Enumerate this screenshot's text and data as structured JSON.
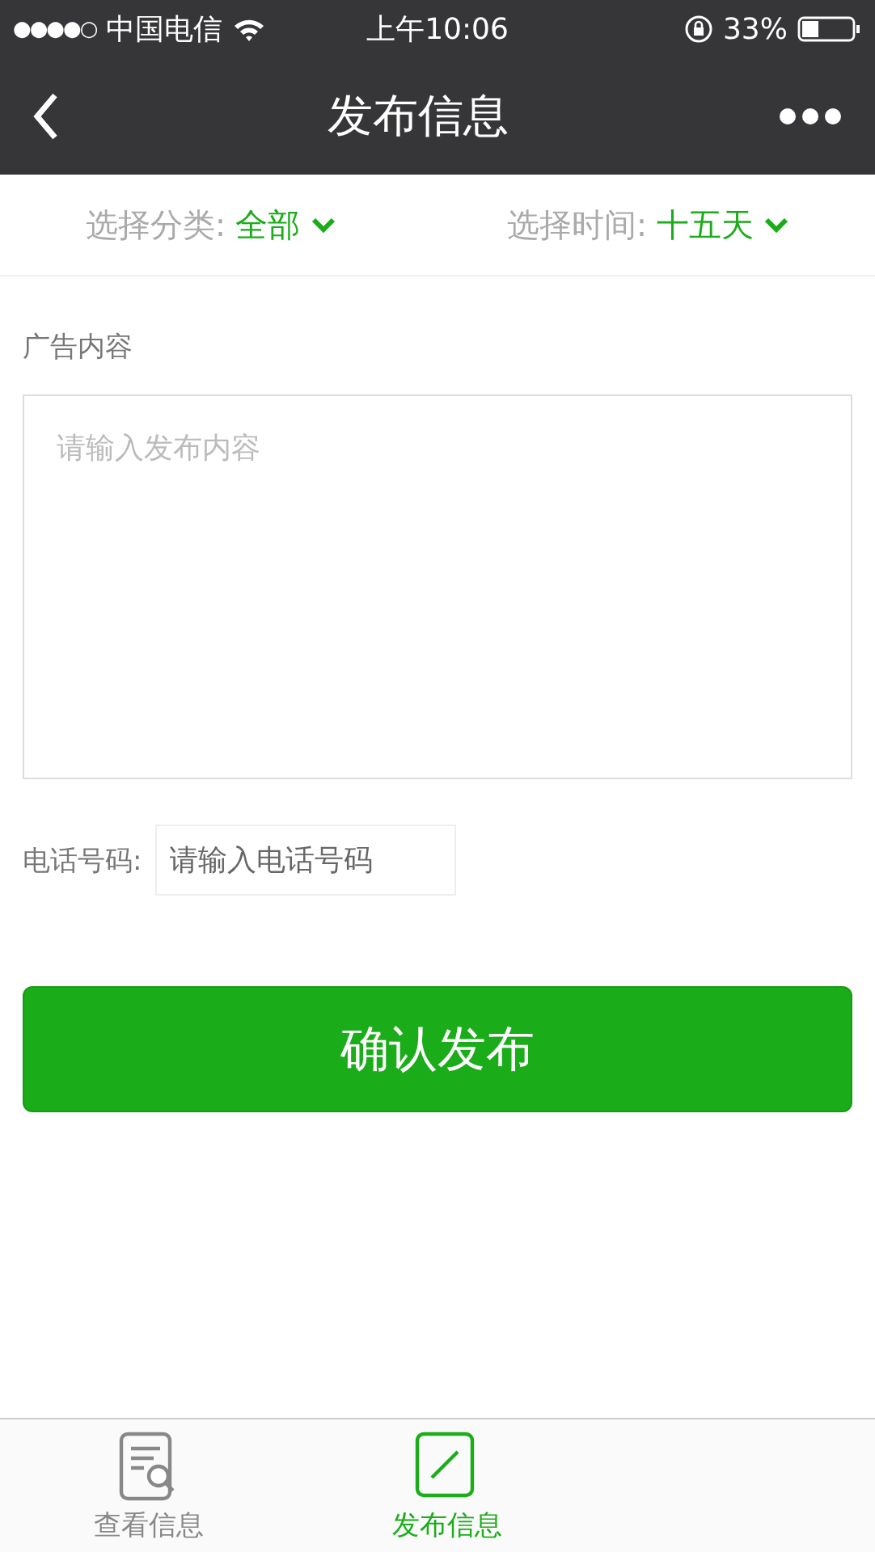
{
  "status_bar": {
    "signal": "●●●●○",
    "carrier": "中国电信",
    "time": "上午10:06",
    "battery": "33%"
  },
  "nav": {
    "title": "发布信息"
  },
  "filters": [
    {
      "label": "选择分类:",
      "value": "全部"
    },
    {
      "label": "选择时间:",
      "value": "十五天"
    }
  ],
  "content": {
    "label": "广告内容",
    "placeholder": "请输入发布内容"
  },
  "phone": {
    "label": "电话号码:",
    "placeholder": "请输入电话号码"
  },
  "submit": "确认发布",
  "tabs": [
    {
      "label": "查看信息",
      "selected": false,
      "kind": "view"
    },
    {
      "label": "发布信息",
      "selected": true,
      "kind": "post"
    }
  ]
}
